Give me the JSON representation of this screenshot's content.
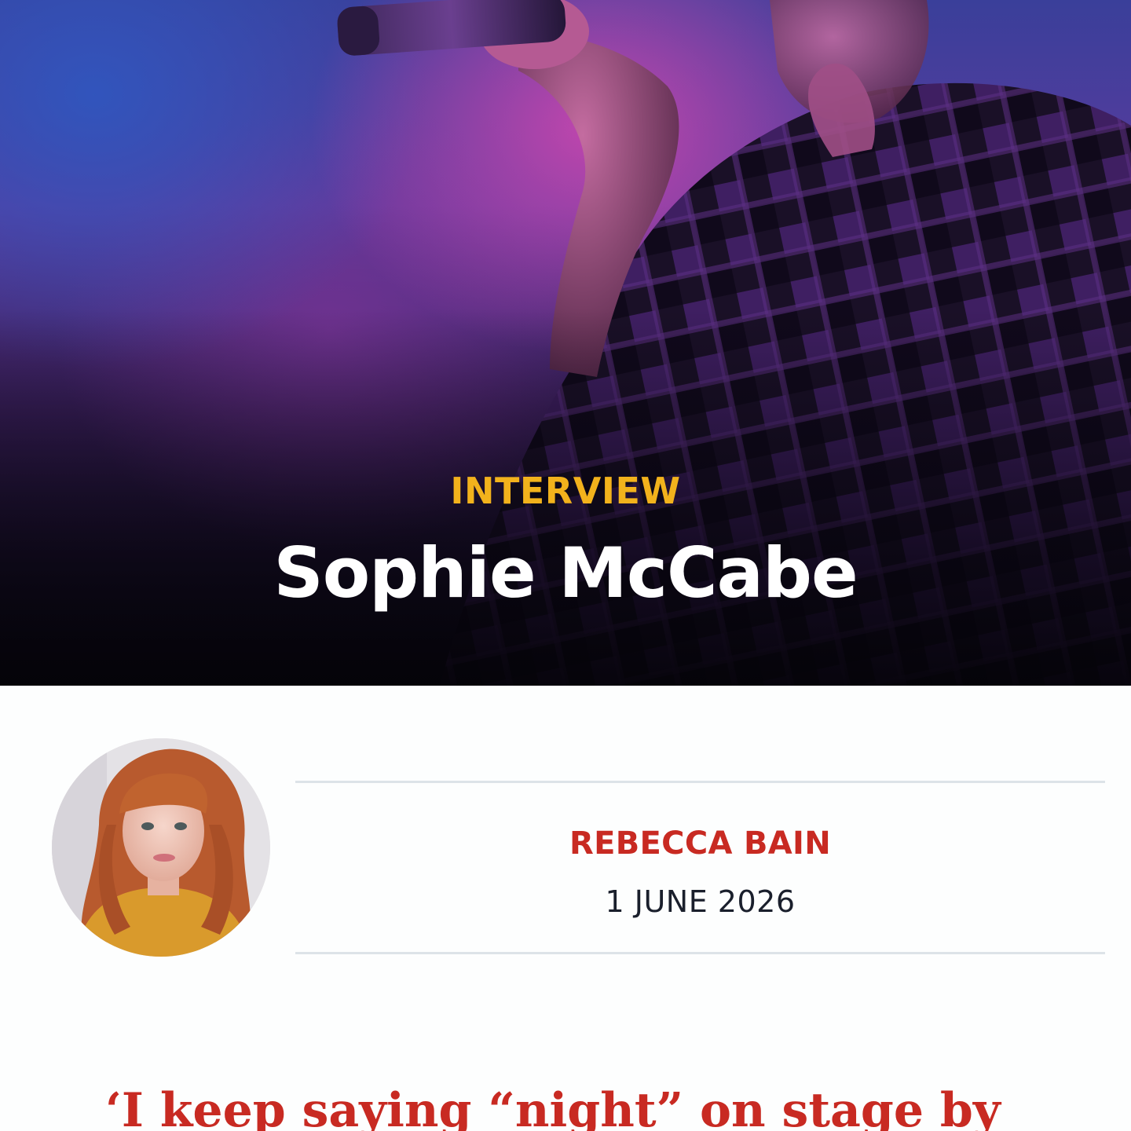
{
  "hero": {
    "label": "INTERVIEW",
    "title": "Sophie McCabe",
    "image": "performer-with-microphone-photo"
  },
  "byline": {
    "author": "REBECCA BAIN",
    "date": "1 JUNE 2026",
    "avatar": "author-portrait-photo"
  },
  "article": {
    "pull_quote": "‘I keep saying “night” on stage by"
  },
  "colors": {
    "accent_yellow": "#f2b21c",
    "accent_red": "#c82a22",
    "rule_grey": "#dde3e8"
  }
}
